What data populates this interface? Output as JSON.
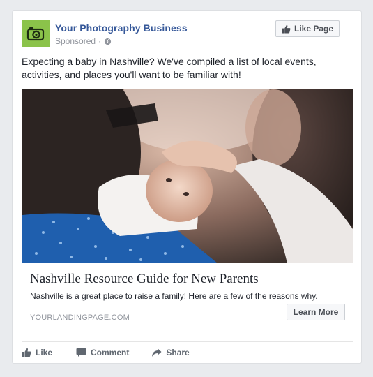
{
  "post": {
    "page_name": "Your Photography Business",
    "sponsored": "Sponsored",
    "separator": "·",
    "like_page_label": "Like Page",
    "body_text": "Expecting a baby in Nashville? We've compiled a list of local events, activities, and places you'll want to be familiar with!"
  },
  "link": {
    "title": "Nashville Resource Guide for New Parents",
    "description": "Nashville is a great place to raise a family! Here are a few of the reasons why.",
    "domain": "YOURLANDINGPAGE.COM",
    "cta_label": "Learn More"
  },
  "actions": {
    "like": "Like",
    "comment": "Comment",
    "share": "Share"
  },
  "icons": {
    "avatar": "camera-icon",
    "privacy": "globe-icon",
    "like_page": "thumbs-up-icon",
    "like": "thumbs-up-icon",
    "comment": "comment-icon",
    "share": "share-arrow-icon"
  },
  "colors": {
    "page_name": "#365899",
    "avatar_bg": "#8bc34a",
    "background": "#e9ebee"
  }
}
